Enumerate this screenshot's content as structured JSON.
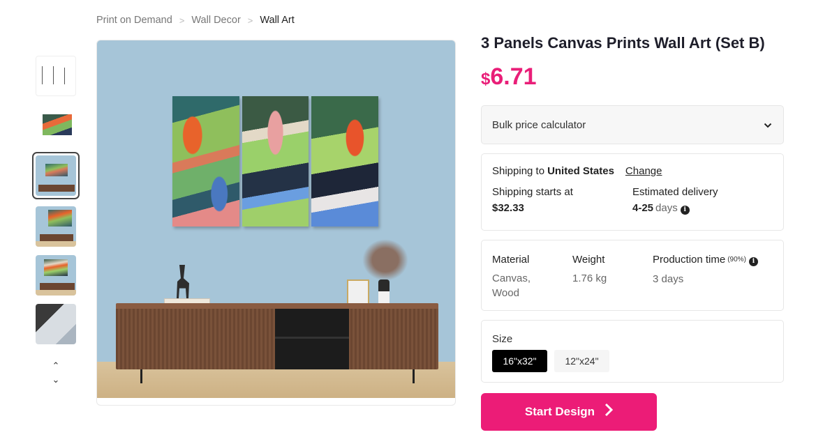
{
  "breadcrumb": {
    "items": [
      "Print on Demand",
      "Wall Decor",
      "Wall Art"
    ],
    "separator": ">"
  },
  "gallery": {
    "thumbnails": [
      {
        "label": "size-chart-thumbnail",
        "active": false
      },
      {
        "label": "angled-panels-thumbnail",
        "active": false
      },
      {
        "label": "living-room-front-thumbnail",
        "active": true
      },
      {
        "label": "living-room-angle-thumbnail",
        "active": false
      },
      {
        "label": "living-room-side-thumbnail",
        "active": false
      },
      {
        "label": "canvas-edge-closeup-thumbnail",
        "active": false
      }
    ],
    "scroll_up": "⌃",
    "scroll_down": "⌄"
  },
  "product": {
    "title": "3 Panels Canvas Prints Wall Art (Set B)",
    "price_currency": "$",
    "price_amount": "6.71",
    "accent_color": "#ec1c77"
  },
  "bulk": {
    "label": "Bulk price calculator",
    "chevron": "⌄"
  },
  "shipping": {
    "prefix": "Shipping to",
    "country": "United States",
    "change_label": "Change",
    "starts_label": "Shipping starts at",
    "starts_value": "$32.33",
    "delivery_label": "Estimated delivery",
    "delivery_value": "4-25",
    "delivery_unit": "days"
  },
  "specs": {
    "material_label": "Material",
    "material_value": "Canvas, Wood",
    "weight_label": "Weight",
    "weight_value": "1.76 kg",
    "production_label": "Production time",
    "production_note": "(90%)",
    "production_value": "3 days"
  },
  "size": {
    "label": "Size",
    "options": [
      "16\"x32\"",
      "12\"x24\""
    ],
    "selected": "16\"x32\""
  },
  "cta": {
    "label": "Start Design",
    "arrow": "❯"
  }
}
